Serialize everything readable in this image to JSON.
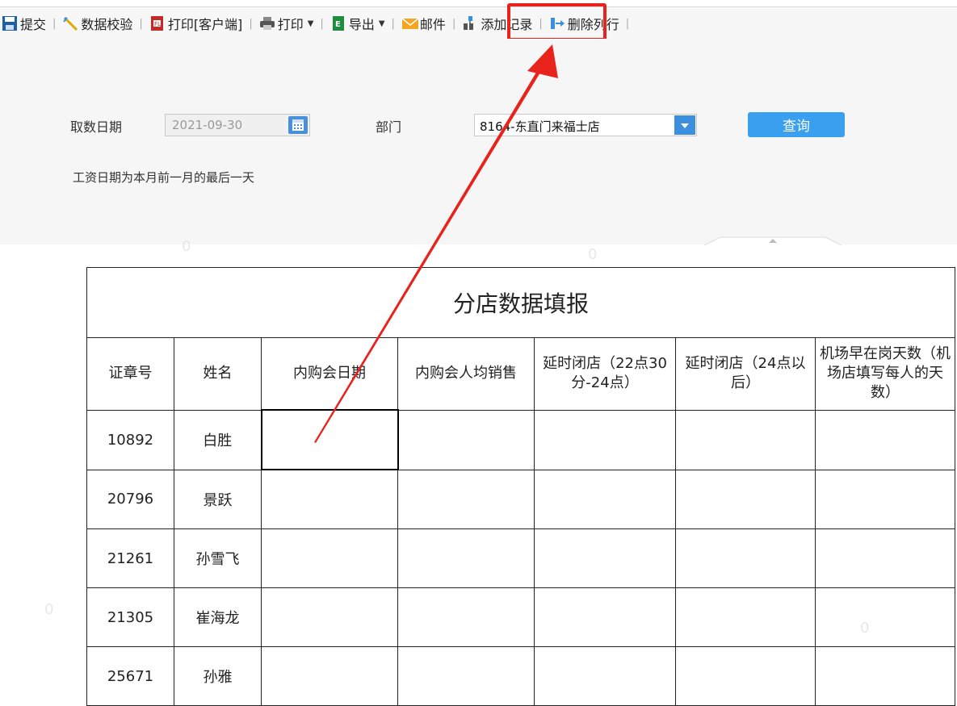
{
  "toolbar": {
    "submit_label": "提交",
    "validate_label": "数据校验",
    "print_client_label": "打印[客户端]",
    "print_label": "打印",
    "export_label": "导出",
    "mail_label": "邮件",
    "add_record_label": "添加记录",
    "delete_row_label": "删除列行"
  },
  "query": {
    "date_label": "取数日期",
    "date_value": "2021-09-30",
    "dept_label": "部门",
    "dept_value": "8164-东直门来福士店",
    "query_button": "查询",
    "note": "工资日期为本月前一月的最后一天"
  },
  "report": {
    "title": "分店数据填报",
    "headers": [
      "证章号",
      "姓名",
      "内购会日期",
      "内购会人均销售",
      "延时闭店（22点30分-24点）",
      "延时闭店（24点以后）",
      "机场早在岗天数（机场店填写每人的天数）"
    ],
    "rows": [
      {
        "id": "10892",
        "name": "白胜"
      },
      {
        "id": "20796",
        "name": "景跃"
      },
      {
        "id": "21261",
        "name": "孙雪飞"
      },
      {
        "id": "21305",
        "name": "崔海龙"
      },
      {
        "id": "25671",
        "name": "孙雅"
      }
    ]
  },
  "colors": {
    "highlight": "#e8231c",
    "arrow": "#e8231c",
    "query_button": "#3b9ff0"
  }
}
